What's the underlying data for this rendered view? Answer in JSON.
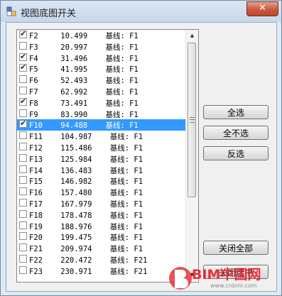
{
  "window": {
    "title": "视图底图开关",
    "close_label": "✕"
  },
  "list": {
    "items": [
      {
        "text": "F2     10.499    基线: F1",
        "checked": true,
        "selected": false
      },
      {
        "text": "F3     20.997    基线: F1",
        "checked": false,
        "selected": false
      },
      {
        "text": "F4     31.496    基线: F1",
        "checked": true,
        "selected": false
      },
      {
        "text": "F5     41.995    基线: F1",
        "checked": true,
        "selected": false
      },
      {
        "text": "F6     52.493    基线: F1",
        "checked": false,
        "selected": false
      },
      {
        "text": "F7     62.992    基线: F1",
        "checked": false,
        "selected": false
      },
      {
        "text": "F8     73.491    基线: F1",
        "checked": true,
        "selected": false
      },
      {
        "text": "F9     83.990    基线: F1",
        "checked": false,
        "selected": false
      },
      {
        "text": "F10    94.488    基线: F1",
        "checked": true,
        "selected": true
      },
      {
        "text": "F11    104.987    基线: F1",
        "checked": false,
        "selected": false
      },
      {
        "text": "F12    115.486    基线: F1",
        "checked": false,
        "selected": false
      },
      {
        "text": "F13    125.984    基线: F1",
        "checked": false,
        "selected": false
      },
      {
        "text": "F14    136.483    基线: F1",
        "checked": false,
        "selected": false
      },
      {
        "text": "F15    146.982    基线: F1",
        "checked": false,
        "selected": false
      },
      {
        "text": "F16    157.480    基线: F1",
        "checked": false,
        "selected": false
      },
      {
        "text": "F17    167.979    基线: F1",
        "checked": false,
        "selected": false
      },
      {
        "text": "F18    178.478    基线: F1",
        "checked": false,
        "selected": false
      },
      {
        "text": "F19    188.976    基线: F1",
        "checked": false,
        "selected": false
      },
      {
        "text": "F20    199.475    基线: F1",
        "checked": false,
        "selected": false
      },
      {
        "text": "F21    209.974    基线: F1",
        "checked": false,
        "selected": false
      },
      {
        "text": "F22    220.472    基线: F21",
        "checked": false,
        "selected": false
      },
      {
        "text": "F23    230.971    基线: F21",
        "checked": false,
        "selected": false
      }
    ]
  },
  "buttons": {
    "select_all": "全选",
    "select_none": "全不选",
    "invert": "反选",
    "close_all": "关闭全部",
    "close_selected": "关闭选中"
  },
  "watermark": {
    "brand": "BIM中国网",
    "url": "www.cnbim.com"
  },
  "colors": {
    "selection": "#3399ff",
    "close": "#c85a3c"
  }
}
